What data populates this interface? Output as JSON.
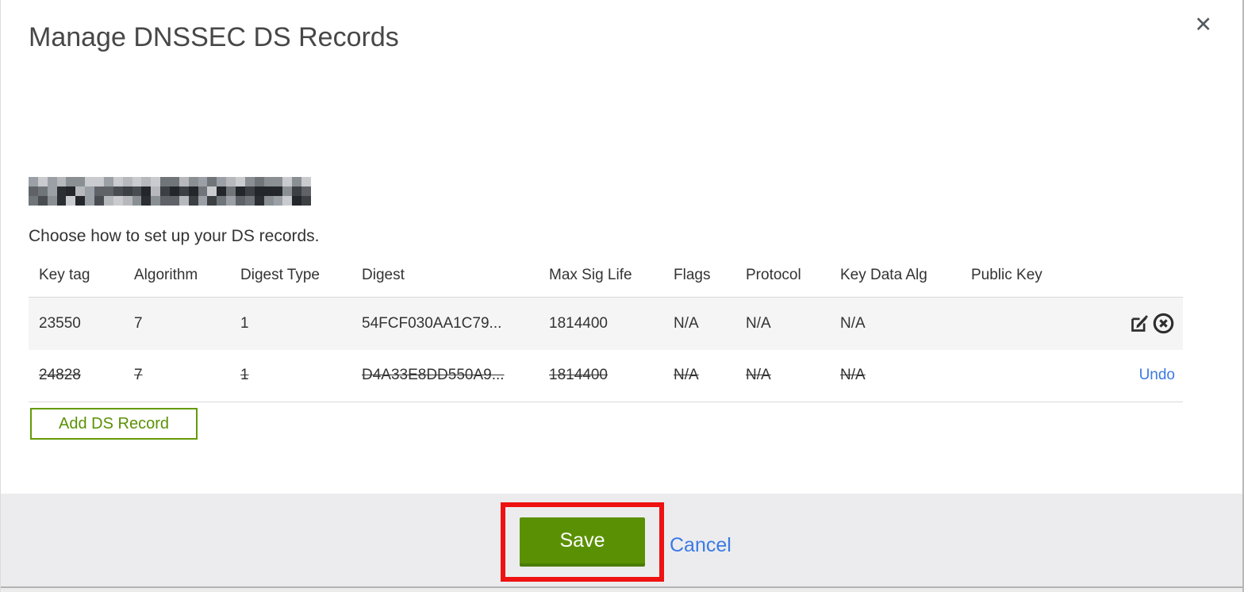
{
  "window": {
    "close_icon": "✕"
  },
  "modal": {
    "title": "Manage DNSSEC DS Records",
    "instruction": "Choose how to set up your DS records.",
    "domain_redacted": true
  },
  "table": {
    "headers": [
      "Key tag",
      "Algorithm",
      "Digest Type",
      "Digest",
      "Max Sig Life",
      "Flags",
      "Protocol",
      "Key Data Alg",
      "Public Key"
    ],
    "column_keys": [
      "key_tag",
      "algorithm",
      "digest_type",
      "digest",
      "max_sig_life",
      "flags",
      "protocol",
      "key_data_alg",
      "public_key"
    ],
    "rows": [
      {
        "key_tag": "23550",
        "algorithm": "7",
        "digest_type": "1",
        "digest": "54FCF030AA1C79...",
        "max_sig_life": "1814400",
        "flags": "N/A",
        "protocol": "N/A",
        "key_data_alg": "N/A",
        "public_key": "",
        "deleted": false,
        "actions": [
          "edit",
          "delete"
        ]
      },
      {
        "key_tag": "24828",
        "algorithm": "7",
        "digest_type": "1",
        "digest": "D4A33E8DD550A9...",
        "max_sig_life": "1814400",
        "flags": "N/A",
        "protocol": "N/A",
        "key_data_alg": "N/A",
        "public_key": "",
        "deleted": true,
        "actions": [
          "undo"
        ],
        "undo_label": "Undo"
      }
    ],
    "icons": {
      "edit": "edit-icon",
      "delete": "delete-icon"
    }
  },
  "buttons": {
    "add_ds_record": "Add DS Record",
    "save": "Save",
    "cancel": "Cancel"
  },
  "colors": {
    "accent_green": "#5a9104",
    "green_border": "#649b06",
    "save_shadow": "#4b7c04",
    "link_blue": "#3b7ae5",
    "annotation_red": "#ee1212",
    "footer_bg": "#ececee",
    "row_alt_bg": "#f5f5f5",
    "title_gray": "#474747"
  },
  "redacted_palette": [
    "#23262a",
    "#3c4043",
    "#5f6368",
    "#70757a",
    "#8a8f94",
    "#9aa0a6",
    "#b6b8bc",
    "#c9cbce",
    "#494d52",
    "#2b2f33"
  ]
}
